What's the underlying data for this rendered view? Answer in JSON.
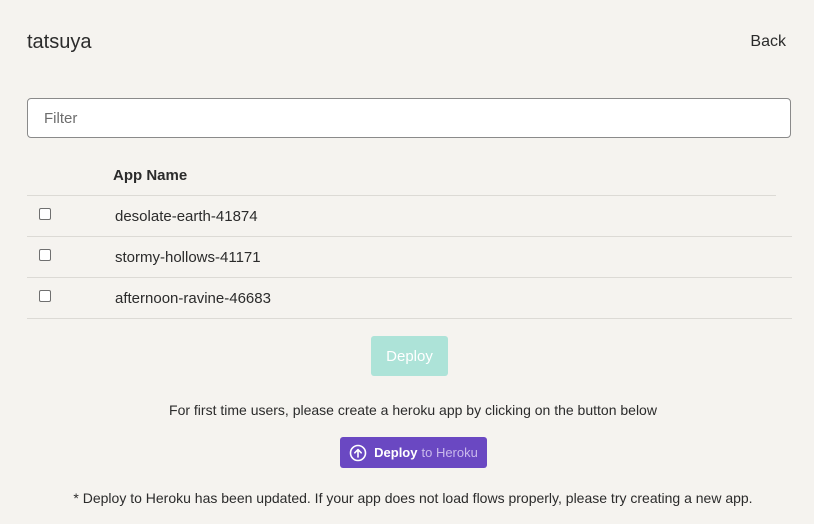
{
  "header": {
    "user_name": "tatsuya",
    "back_label": "Back"
  },
  "filter": {
    "placeholder": "Filter",
    "value": ""
  },
  "table": {
    "column_header": "App Name",
    "rows": [
      {
        "name": "desolate-earth-41874",
        "checked": false
      },
      {
        "name": "stormy-hollows-41171",
        "checked": false
      },
      {
        "name": "afternoon-ravine-46683",
        "checked": false
      }
    ]
  },
  "deploy_button": {
    "label": "Deploy",
    "disabled": true,
    "color": "#ade3d8"
  },
  "first_time_text": "For first time users, please create a heroku app by clicking on the button below",
  "heroku_button": {
    "label_primary": "Deploy",
    "label_secondary": "to Heroku",
    "icon": "upload-cloud-icon",
    "color": "#6a48c2"
  },
  "updated_note": "* Deploy to Heroku has been updated. If your app does not load flows properly, please try creating a new app."
}
